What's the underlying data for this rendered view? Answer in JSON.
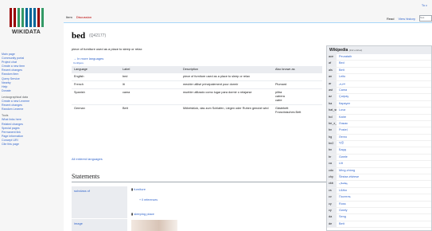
{
  "brand": {
    "logo_text": "WIKIDATA",
    "bar_colors": [
      "#990000",
      "#990000",
      "#339966",
      "#339966",
      "#006699",
      "#006699",
      "#006699",
      "#990000",
      "#339966"
    ]
  },
  "user": {
    "link": "To ε"
  },
  "sidebar": {
    "nav": [
      "Main page",
      "Community portal",
      "Project chat",
      "Create a new item",
      "Recent changes",
      "Random item",
      "Query Service",
      "Nearby",
      "Help",
      "Donate"
    ],
    "lexeme_head": "Lexicographical data",
    "lexeme": [
      "Create a new Lexeme",
      "Recent changes",
      "Random Lexeme"
    ],
    "tools_head": "Tools",
    "tools": [
      "What links here",
      "Related changes",
      "Special pages",
      "Permanent link",
      "Page information",
      "Concept URI",
      "Cite this page"
    ]
  },
  "tabs": {
    "item": "Item",
    "discussion": "Discussion",
    "read": "Read",
    "history": "View history",
    "search_placeholder": "Sea"
  },
  "item": {
    "label": "bed",
    "qid": "(Q42177)",
    "description": "piece of furniture used as a place to sleep or relax",
    "in_more_languages": "→ In more languages",
    "configure": "Configure"
  },
  "terms": {
    "headers": [
      "Language",
      "Label",
      "Description",
      "Also known as"
    ],
    "rows": [
      {
        "lang": "English",
        "label": "bed",
        "desc": "piece of furniture used as a place to sleep or relax",
        "aka": ""
      },
      {
        "lang": "French",
        "label": "lit",
        "desc": "meuble utilisé principalement pour dormir",
        "aka": "Plumard"
      },
      {
        "lang": "Spanish",
        "label": "cama",
        "desc": "mueble utilizado como lugar para dormir o relajarse",
        "aka": "piltra\ncatrera\ncatre"
      },
      {
        "lang": "German",
        "label": "Bett",
        "desc": "Möbelstück, das zum Schlafen, Liegen oder Ruhen genutzt wird",
        "aka": "Gästebett\nFranzösisches Bett"
      }
    ]
  },
  "all_entered": "All entered languages",
  "statements": {
    "heading": "Statements",
    "subclass_prop": "subclass of",
    "values": [
      "furniture",
      "sleeping place"
    ],
    "refs": [
      "+ 0 references",
      "+ 0 references"
    ],
    "image_prop": "image"
  },
  "wikipedia": {
    "title": "Wikipedia",
    "count": "(112 entries)",
    "entries": [
      {
        "code": "ace",
        "title": "Peurataih"
      },
      {
        "code": "af",
        "title": "Bed"
      },
      {
        "code": "als",
        "title": "Bett"
      },
      {
        "code": "an",
        "title": "Leito"
      },
      {
        "code": "ar",
        "title": "سرير"
      },
      {
        "code": "ast",
        "title": "Cama"
      },
      {
        "code": "az",
        "title": "Çərpay"
      },
      {
        "code": "ba",
        "title": "Карауат"
      },
      {
        "code": "bat_smg",
        "title": "Lova"
      },
      {
        "code": "bcl",
        "title": "Katre"
      },
      {
        "code": "be_x_old",
        "title": "Ложак"
      },
      {
        "code": "bn",
        "title": "Posteļ"
      },
      {
        "code": "bg",
        "title": "Легло"
      },
      {
        "code": "bn2",
        "title": "খাট"
      },
      {
        "code": "bn",
        "title": "Бард"
      },
      {
        "code": "br",
        "title": "Gwele"
      },
      {
        "code": "ca",
        "title": "Llit"
      },
      {
        "code": "cdo",
        "title": "Mìng-chòng"
      },
      {
        "code": "chy",
        "title": "Šėstse-éšéese"
      },
      {
        "code": "ckb",
        "title": "پێخەف"
      },
      {
        "code": "cs",
        "title": "Lůžko"
      },
      {
        "code": "cv",
        "title": "Постель"
      },
      {
        "code": "cy",
        "title": "Ross"
      },
      {
        "code": "cy",
        "title": "Gwely"
      },
      {
        "code": "da",
        "title": "Seng"
      },
      {
        "code": "de",
        "title": "Bett"
      }
    ]
  }
}
